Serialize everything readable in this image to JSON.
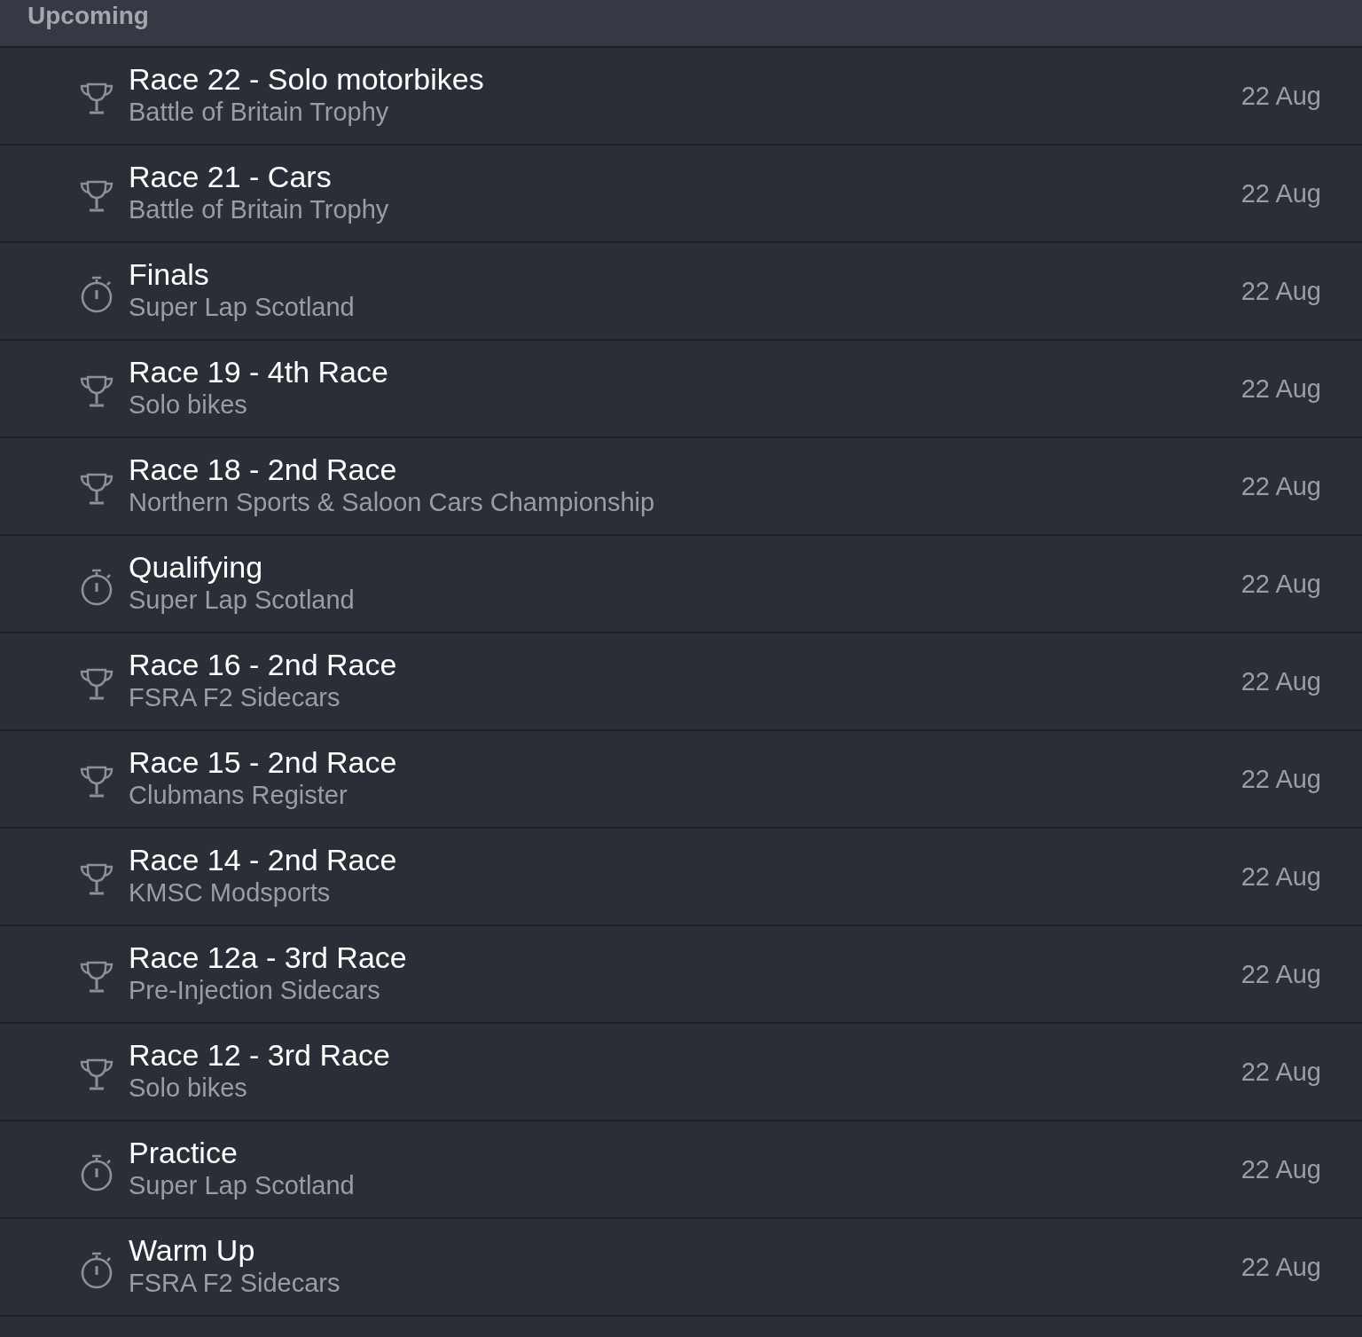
{
  "section": {
    "title": "Upcoming"
  },
  "events": [
    {
      "kind": "race",
      "title": "Race 22 - Solo motorbikes",
      "subtitle": "Battle of Britain Trophy",
      "date": "22 Aug"
    },
    {
      "kind": "race",
      "title": "Race 21 - Cars",
      "subtitle": "Battle of Britain Trophy",
      "date": "22 Aug"
    },
    {
      "kind": "timed",
      "title": "Finals",
      "subtitle": "Super Lap Scotland",
      "date": "22 Aug"
    },
    {
      "kind": "race",
      "title": "Race 19 - 4th Race",
      "subtitle": "Solo bikes",
      "date": "22 Aug"
    },
    {
      "kind": "race",
      "title": "Race 18 - 2nd Race",
      "subtitle": "Northern Sports & Saloon Cars Championship",
      "date": "22 Aug"
    },
    {
      "kind": "timed",
      "title": "Qualifying",
      "subtitle": "Super Lap Scotland",
      "date": "22 Aug"
    },
    {
      "kind": "race",
      "title": "Race 16 - 2nd Race",
      "subtitle": "FSRA F2 Sidecars",
      "date": "22 Aug"
    },
    {
      "kind": "race",
      "title": "Race 15 - 2nd Race",
      "subtitle": "Clubmans Register",
      "date": "22 Aug"
    },
    {
      "kind": "race",
      "title": "Race 14 - 2nd Race",
      "subtitle": "KMSC Modsports",
      "date": "22 Aug"
    },
    {
      "kind": "race",
      "title": "Race 12a - 3rd Race",
      "subtitle": "Pre-Injection Sidecars",
      "date": "22 Aug"
    },
    {
      "kind": "race",
      "title": "Race 12 - 3rd Race",
      "subtitle": "Solo bikes",
      "date": "22 Aug"
    },
    {
      "kind": "timed",
      "title": "Practice",
      "subtitle": "Super Lap Scotland",
      "date": "22 Aug"
    },
    {
      "kind": "timed",
      "title": "Warm Up",
      "subtitle": "FSRA F2 Sidecars",
      "date": "22 Aug"
    }
  ]
}
